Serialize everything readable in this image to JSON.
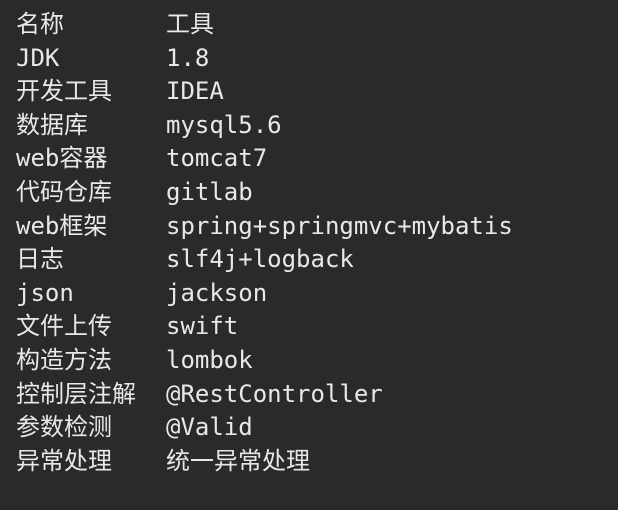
{
  "rows": [
    {
      "name": "名称",
      "value": "工具"
    },
    {
      "name": "JDK",
      "value": "1.8"
    },
    {
      "name": "开发工具",
      "value": "IDEA"
    },
    {
      "name": "数据库",
      "value": "mysql5.6"
    },
    {
      "name": "web容器",
      "value": "tomcat7"
    },
    {
      "name": "代码仓库",
      "value": "gitlab"
    },
    {
      "name": "web框架",
      "value": "spring+springmvc+mybatis"
    },
    {
      "name": "日志",
      "value": "slf4j+logback"
    },
    {
      "name": "json",
      "value": "jackson"
    },
    {
      "name": "文件上传",
      "value": "swift"
    },
    {
      "name": "构造方法",
      "value": "lombok"
    },
    {
      "name": "控制层注解",
      "value": "@RestController"
    },
    {
      "name": "参数检测",
      "value": "@Valid"
    },
    {
      "name": "异常处理",
      "value": "统一异常处理"
    }
  ]
}
